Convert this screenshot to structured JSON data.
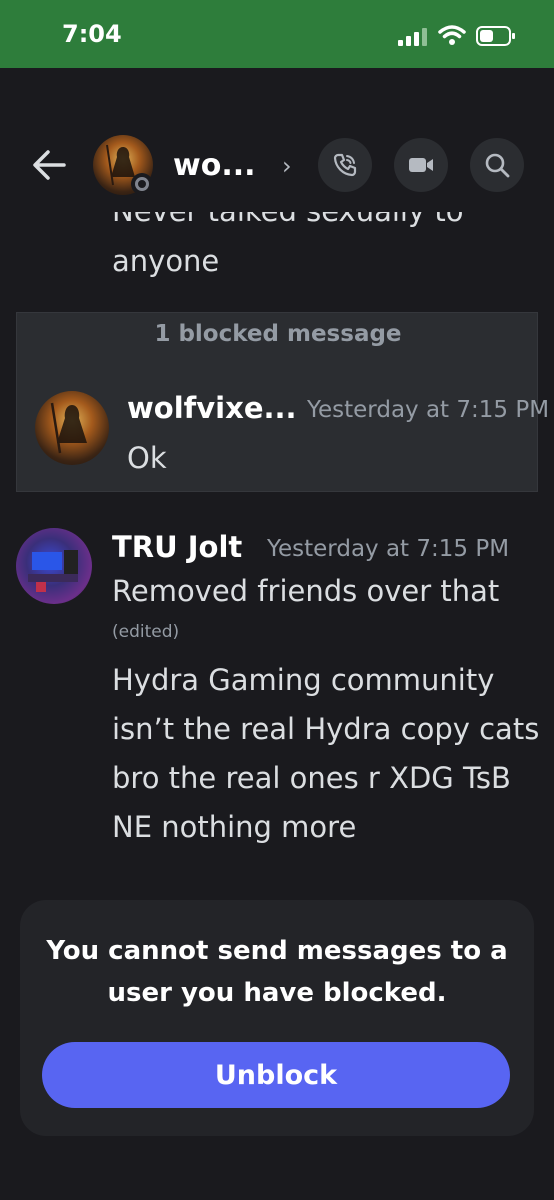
{
  "status_bar": {
    "time": "7:04",
    "background": "#2e7d3b",
    "icons": [
      "signal-icon",
      "wifi-icon",
      "battery-icon"
    ]
  },
  "header": {
    "name": "wo...",
    "chevron": "›",
    "icons": [
      "back-arrow-icon",
      "phone-call-icon",
      "video-camera-icon",
      "search-icon"
    ]
  },
  "messages": {
    "previous_line_1": "Never talked sexually to",
    "previous_line_2": "anyone",
    "blocked_group": {
      "label": "1 blocked message",
      "author": "wolfvixe...",
      "timestamp": "Yesterday at 7:15 PM",
      "text": "Ok"
    },
    "message": {
      "author": "TRU Jolt",
      "timestamp": "Yesterday at 7:15 PM",
      "text_1": "Removed friends over that",
      "edited": "(edited)",
      "text_2": "Hydra Gaming community isn’t the real Hydra copy cats bro the real ones r XDG TsB NE nothing more"
    }
  },
  "blocked_panel": {
    "text": "You cannot send messages to a user you have blocked.",
    "button_label": "Unblock",
    "button_color": "#5865f2"
  }
}
